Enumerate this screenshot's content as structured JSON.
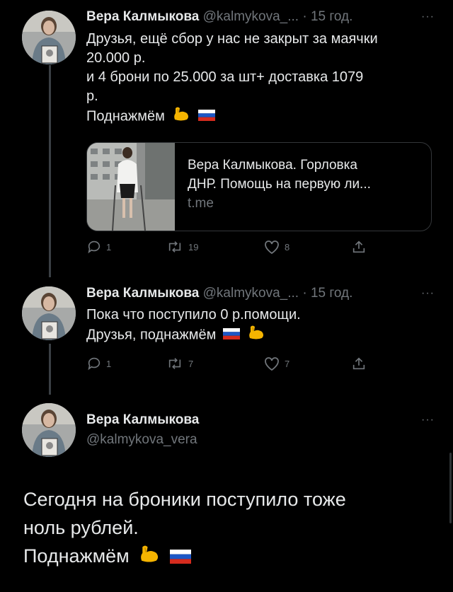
{
  "tweet1": {
    "name": "Вера Калмыкова",
    "handle": "@kalmykova_...",
    "time": "· 15 год.",
    "more": "···",
    "lines": [
      "Друзья, ещё сбор у нас не закрыт за маячки",
      "20.000 р.",
      "и 4 брони по 25.000 за шт+ доставка 1079",
      "р.",
      "Поднажмём"
    ],
    "card": {
      "title_line1": "Вера Калмыкова. Горловка",
      "title_line2": "ДНР. Помощь на первую ли...",
      "domain": "t.me"
    },
    "replies": "1",
    "retweets": "19",
    "likes": "8"
  },
  "tweet2": {
    "name": "Вера Калмыкова",
    "handle": "@kalmykova_...",
    "time": "· 15 год.",
    "more": "···",
    "lines": [
      "Пока что поступило 0 р.помощи.",
      "Друзья, поднажмём"
    ],
    "replies": "1",
    "retweets": "7",
    "likes": "7"
  },
  "tweet3": {
    "name": "Вера Калмыкова",
    "handle": "@kalmykova_vera",
    "more": "···",
    "lines": [
      "Сегодня на броники  поступило тоже",
      "ноль рублей.",
      "Поднажмём"
    ]
  },
  "colors": {
    "background": "#000000",
    "text": "#e7e9ea",
    "muted": "#71767b"
  }
}
